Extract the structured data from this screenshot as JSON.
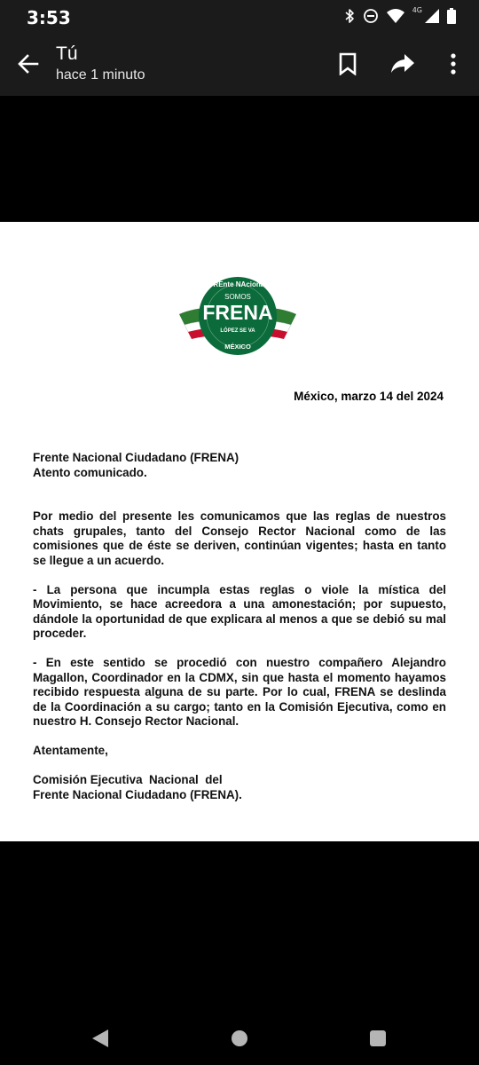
{
  "status_bar": {
    "time": "3:53",
    "network_label": "4G",
    "icons": [
      "bluetooth-icon",
      "do-not-disturb-icon",
      "wifi-icon",
      "signal-icon",
      "battery-icon"
    ]
  },
  "app_bar": {
    "title": "Tú",
    "subtitle": "hace 1 minuto",
    "actions": [
      "bookmark-icon",
      "share-icon",
      "more-vert-icon"
    ]
  },
  "document": {
    "logo": {
      "top_text": "FREnte NAcional",
      "somos": "SOMOS",
      "name": "FRENA",
      "slogan": "LÓPEZ SE VA",
      "bottom_text": "MÉXICO"
    },
    "date": "México, marzo 14 del 2024",
    "addressee": {
      "line1": "Frente Nacional Ciudadano (FRENA)",
      "line2": "Atento comunicado."
    },
    "paragraph1": "Por medio del presente les comunicamos que las reglas de nuestros chats grupales, tanto del Consejo Rector Nacional como de las comisiones que de éste se deriven, continúan vigentes; hasta en tanto se llegue a un acuerdo.",
    "paragraph2": "- La persona que incumpla estas reglas o viole la mística del Movimiento, se hace acreedora a una amonestación; por supuesto, dándole la oportunidad de que explicara al menos a que se debió su mal proceder.",
    "paragraph3": "- En este sentido se procedió con nuestro compañero Alejandro Magallon, Coordinador en la CDMX, sin que hasta el momento hayamos recibido respuesta alguna de su parte. Por lo cual, FRENA se deslinda de la Coordinación a su cargo; tanto en la Comisión Ejecutiva, como en nuestro H. Consejo Rector Nacional.",
    "closing": "Atentamente,",
    "signature": {
      "line1": "Comisión Ejecutiva  Nacional  del",
      "line2": "Frente Nacional Ciudadano (FRENA)."
    }
  },
  "nav_bar": {
    "buttons": [
      "nav-back-icon",
      "nav-home-icon",
      "nav-recents-icon"
    ]
  },
  "colors": {
    "bar_background": "#1b1b1b",
    "document_background": "#ffffff",
    "logo_green": "#0b6b3a",
    "logo_red": "#c8102e"
  }
}
